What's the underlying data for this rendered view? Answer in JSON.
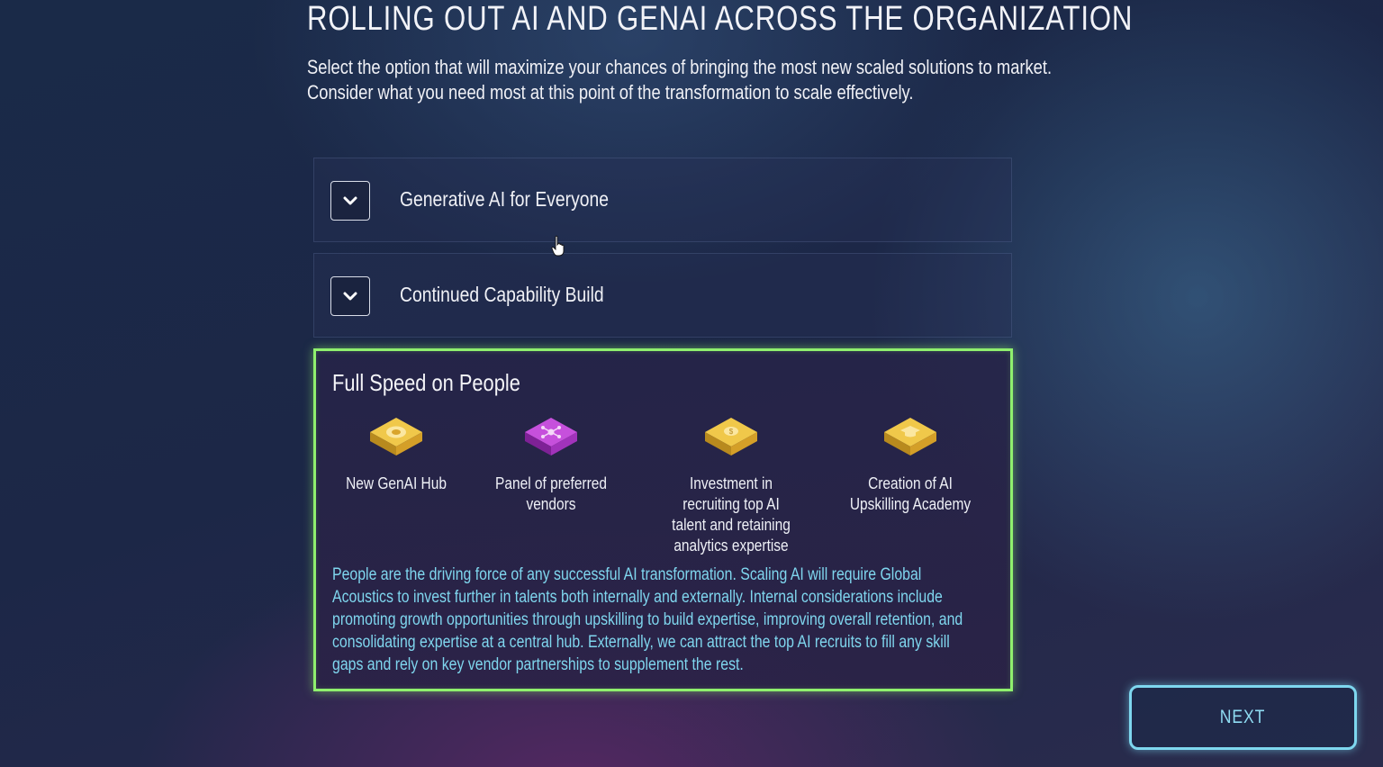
{
  "header": {
    "title": "ROLLING OUT AI AND GENAI ACROSS THE ORGANIZATION",
    "subtitle": "Select the option that will maximize your chances of bringing the most new scaled solutions to market. Consider what you need most at this point of the transformation to scale effectively."
  },
  "options": [
    {
      "label": "Generative AI for Everyone",
      "icon": "chevron-down-icon"
    },
    {
      "label": "Continued Capability Build",
      "icon": "chevron-down-icon"
    }
  ],
  "selected": {
    "title": "Full Speed on People",
    "features": [
      {
        "label": "New GenAI Hub",
        "icon": "hub-icon",
        "color": "#e6b93a"
      },
      {
        "label": "Panel of preferred vendors",
        "icon": "vendors-icon",
        "color": "#b540d0"
      },
      {
        "label": "Investment in recruiting top AI talent and retaining analytics expertise",
        "icon": "investment-icon",
        "color": "#e6b93a"
      },
      {
        "label": "Creation of AI Upskilling Academy",
        "icon": "graduation-cap-icon",
        "color": "#e6b93a"
      }
    ],
    "description": "People are the driving force of any successful AI transformation. Scaling AI will require Global Acoustics to invest further in talents both internally and externally. Internal considerations include promoting growth opportunities through upskilling to build expertise, improving overall retention, and consolidating expertise at a central hub. Externally, we can attract the top AI recruits to fill any skill gaps and rely on key vendor partnerships to supplement the rest.",
    "border_color": "#8ff06e"
  },
  "footer": {
    "next_label": "NEXT",
    "accent_color": "#7ed7ef"
  }
}
